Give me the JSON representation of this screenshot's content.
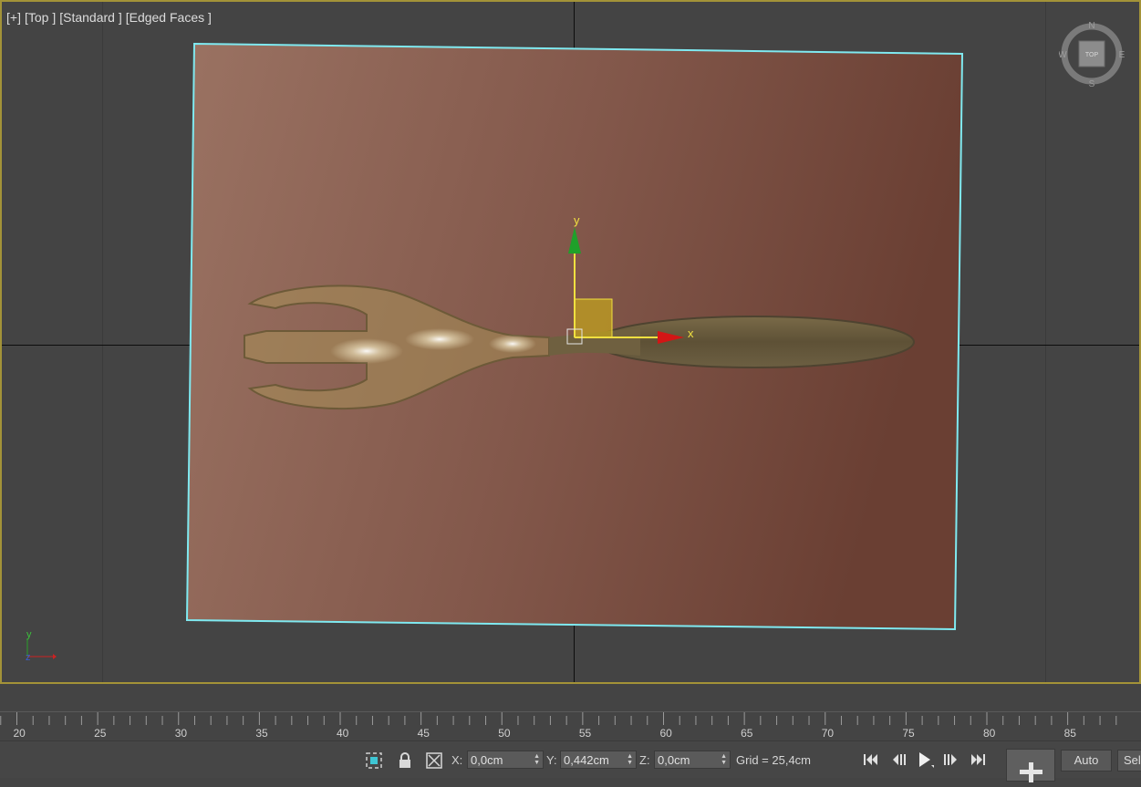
{
  "viewport": {
    "label_plus": "[+]",
    "label_view": "[Top ]",
    "label_shading": "[Standard ]",
    "label_mode": "[Edged Faces ]",
    "gizmo_x_label": "x",
    "gizmo_y_label": "y"
  },
  "viewcube": {
    "north": "N",
    "south": "S",
    "east": "E",
    "west": "W",
    "face": "TOP"
  },
  "mini_axes": {
    "y": "y",
    "z": "z"
  },
  "timeline": {
    "ruler_labels": [
      "20",
      "25",
      "30",
      "35",
      "40",
      "45",
      "50",
      "55",
      "60",
      "65",
      "70",
      "75",
      "80",
      "85"
    ]
  },
  "status": {
    "x_label": "X:",
    "x_value": "0,0cm",
    "y_label": "Y:",
    "y_value": "0,442cm",
    "z_label": "Z:",
    "z_value": "0,0cm",
    "grid": "Grid = 25,4cm",
    "auto_label": "Auto",
    "sel_label": "Sel"
  },
  "colors": {
    "viewport_border": "#a39338",
    "plane_outline": "#7fe9f0",
    "gizmo_yellow": "#f0e040",
    "gizmo_green": "#1fa02a",
    "gizmo_red": "#d31515"
  }
}
